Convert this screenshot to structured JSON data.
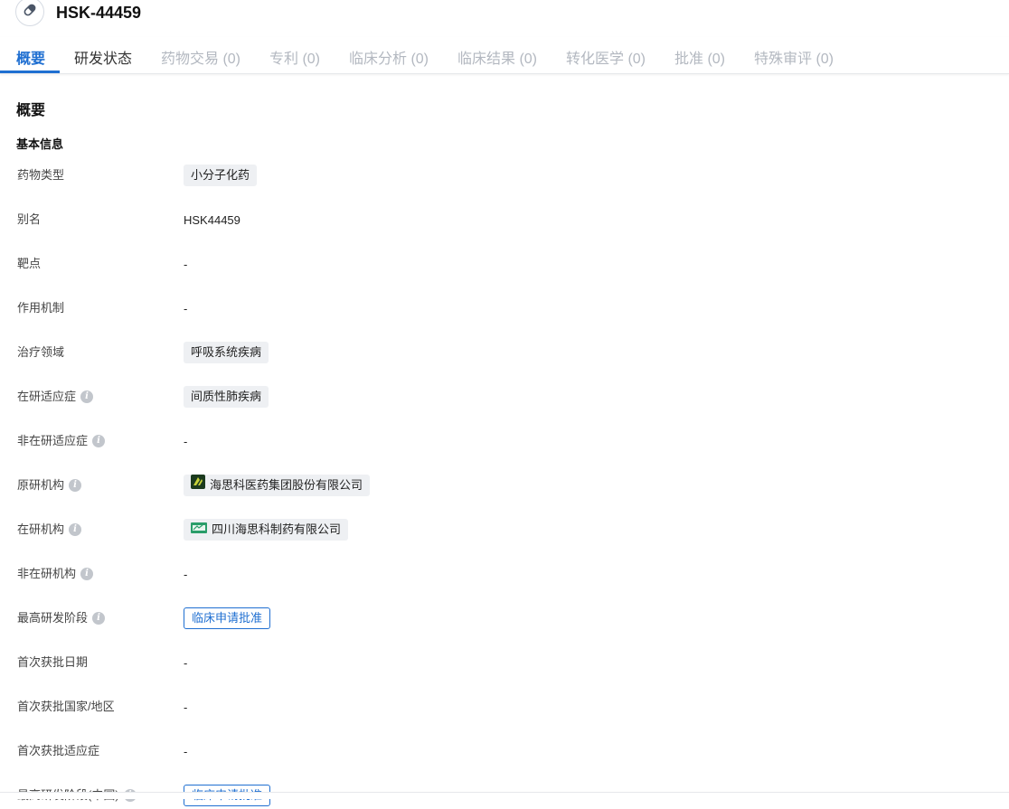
{
  "header": {
    "title": "HSK-44459",
    "icon": "pill-icon"
  },
  "tabs": [
    {
      "label": "概要",
      "state": "active"
    },
    {
      "label": "研发状态",
      "state": "enabled"
    },
    {
      "label": "药物交易 (0)",
      "state": "disabled"
    },
    {
      "label": "专利 (0)",
      "state": "disabled"
    },
    {
      "label": "临床分析 (0)",
      "state": "disabled"
    },
    {
      "label": "临床结果 (0)",
      "state": "disabled"
    },
    {
      "label": "转化医学 (0)",
      "state": "disabled"
    },
    {
      "label": "批准 (0)",
      "state": "disabled"
    },
    {
      "label": "特殊审评 (0)",
      "state": "disabled"
    }
  ],
  "overview": {
    "section_title": "概要",
    "basic_info_title": "基本信息",
    "fields": {
      "drug_type": {
        "label": "药物类型",
        "value": "小分子化药"
      },
      "alias": {
        "label": "别名",
        "value": "HSK44459"
      },
      "target": {
        "label": "靶点",
        "value": "-"
      },
      "mechanism": {
        "label": "作用机制",
        "value": "-"
      },
      "therapeutic_area": {
        "label": "治疗领域",
        "value": "呼吸系统疾病"
      },
      "active_indication": {
        "label": "在研适应症",
        "value": "间质性肺疾病"
      },
      "inactive_indication": {
        "label": "非在研适应症",
        "value": "-"
      },
      "originator": {
        "label": "原研机构",
        "value": "海思科医药集团股份有限公司"
      },
      "active_org": {
        "label": "在研机构",
        "value": "四川海思科制药有限公司"
      },
      "inactive_org": {
        "label": "非在研机构",
        "value": "-"
      },
      "highest_phase": {
        "label": "最高研发阶段",
        "value": "临床申请批准"
      },
      "first_approval_date": {
        "label": "首次获批日期",
        "value": "-"
      },
      "first_approval_country": {
        "label": "首次获批国家/地区",
        "value": "-"
      },
      "first_approval_indication": {
        "label": "首次获批适应症",
        "value": "-"
      },
      "highest_phase_china": {
        "label": "最高研发阶段(中国)",
        "value": "临床申请批准"
      }
    }
  },
  "colors": {
    "accent": "#1f6fd1",
    "chip_bg": "#eef0f3",
    "disabled_tab": "#b3b8c0"
  }
}
